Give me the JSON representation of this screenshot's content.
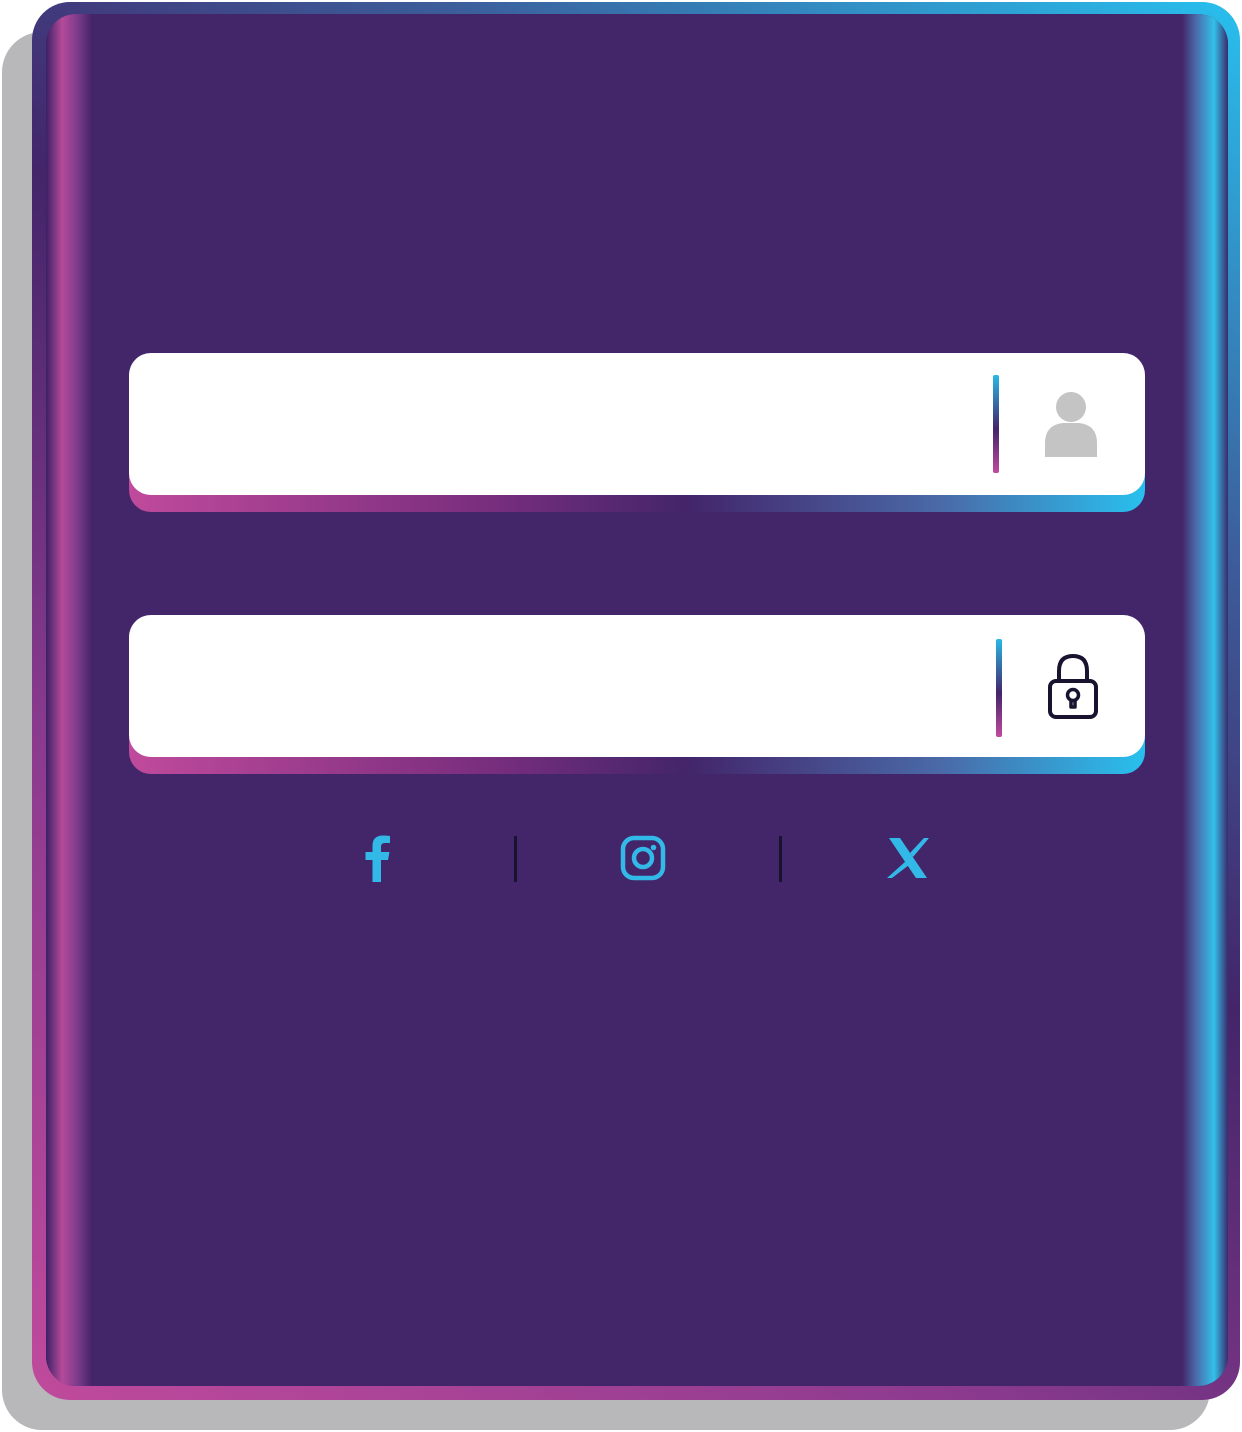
{
  "login_form": {
    "username_field": {
      "value": "",
      "placeholder": "",
      "icon": "user-icon"
    },
    "password_field": {
      "value": "",
      "placeholder": "",
      "icon": "lock-icon"
    }
  },
  "social_links": [
    {
      "name": "facebook",
      "icon": "facebook-icon"
    },
    {
      "name": "instagram",
      "icon": "instagram-icon"
    },
    {
      "name": "x",
      "icon": "x-icon"
    }
  ],
  "colors": {
    "panel_background": "#43256a",
    "accent_cyan": "#28c0ee",
    "accent_magenta": "#c04a9c",
    "social_icon": "#33b9e8",
    "user_icon": "#c4c4c4",
    "lock_icon": "#1a1330"
  }
}
